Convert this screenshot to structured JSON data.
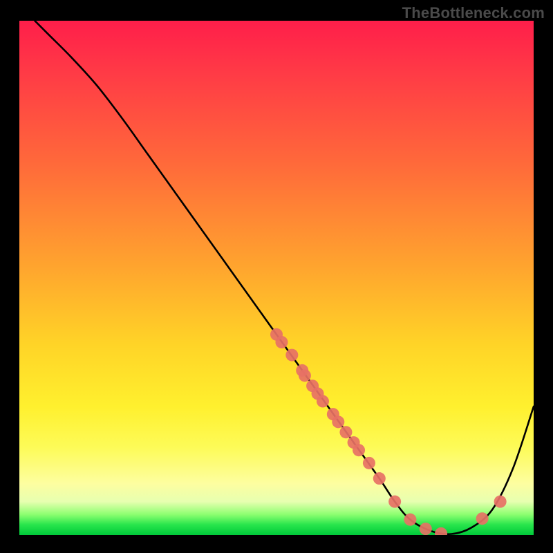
{
  "watermark": "TheBottleneck.com",
  "chart_data": {
    "type": "line",
    "title": "",
    "xlabel": "",
    "ylabel": "",
    "xlim": [
      0,
      100
    ],
    "ylim": [
      0,
      100
    ],
    "grid": false,
    "legend": false,
    "series": [
      {
        "name": "bottleneck-curve",
        "color": "#000000",
        "x": [
          3,
          6,
          10,
          15,
          20,
          25,
          30,
          35,
          40,
          45,
          50,
          55,
          60,
          65,
          70,
          73,
          76,
          80,
          84,
          88,
          92,
          96,
          100
        ],
        "y": [
          100,
          97,
          93,
          87.5,
          81,
          74,
          67,
          60,
          53,
          46,
          39,
          32,
          25,
          18,
          11,
          6.5,
          3,
          0.8,
          0.2,
          1.5,
          5,
          13,
          25
        ]
      }
    ],
    "markers": {
      "name": "highlight-points",
      "color": "#e77165",
      "radius_px": 9,
      "x": [
        50,
        51,
        53,
        55,
        55.5,
        57,
        58,
        59,
        61,
        62,
        63.5,
        65,
        66,
        68,
        70,
        73,
        76,
        79,
        82,
        90,
        93.5
      ],
      "y": [
        39,
        37.5,
        35,
        32,
        31,
        29,
        27.5,
        26,
        23.5,
        22,
        20,
        18,
        16.5,
        14,
        11,
        6.5,
        3,
        1.2,
        0.3,
        3.2,
        6.5
      ]
    }
  }
}
